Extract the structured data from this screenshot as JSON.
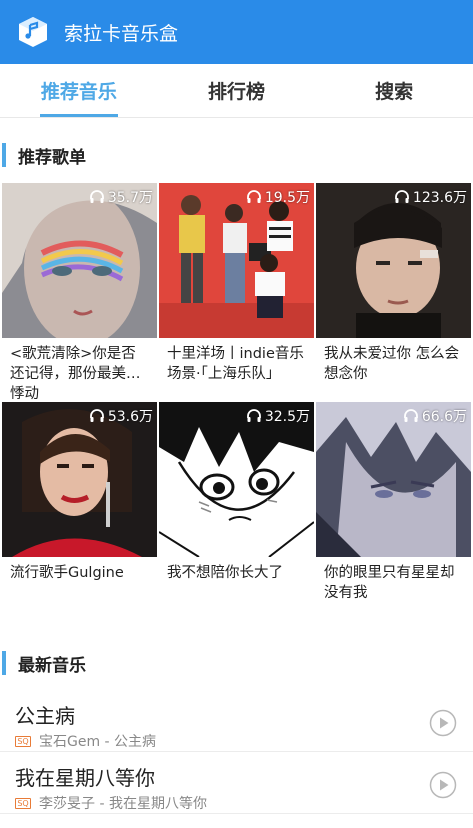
{
  "app": {
    "title": "索拉卡音乐盒",
    "brand_color": "#2a8be8",
    "accent_color": "#4ea8e6",
    "logo_icon": "music-box-icon"
  },
  "tabs": [
    {
      "label": "推荐音乐",
      "active": true
    },
    {
      "label": "排行榜",
      "active": false
    },
    {
      "label": "搜索",
      "active": false
    }
  ],
  "recommend": {
    "heading": "推荐歌单",
    "playlists": [
      {
        "title": "<歌荒清除>你是否还记得，那份最美的悸动",
        "play_count": "35.7万"
      },
      {
        "title": "十里洋场丨indie音乐场景·「上海乐队」",
        "play_count": "19.5万"
      },
      {
        "title": "我从未爱过你 怎么会想念你",
        "play_count": "123.6万"
      },
      {
        "title": "流行歌手Gulgine",
        "play_count": "53.6万"
      },
      {
        "title": "我不想陪你长大了",
        "play_count": "32.5万"
      },
      {
        "title": "你的眼里只有星星却没有我",
        "play_count": "66.6万"
      }
    ]
  },
  "latest": {
    "heading": "最新音乐",
    "songs": [
      {
        "name": "公主病",
        "badge": "SQ",
        "subtitle": "宝石Gem - 公主病"
      },
      {
        "name": "我在星期八等你",
        "badge": "SQ",
        "subtitle": "李莎旻子 - 我在星期八等你"
      }
    ]
  }
}
